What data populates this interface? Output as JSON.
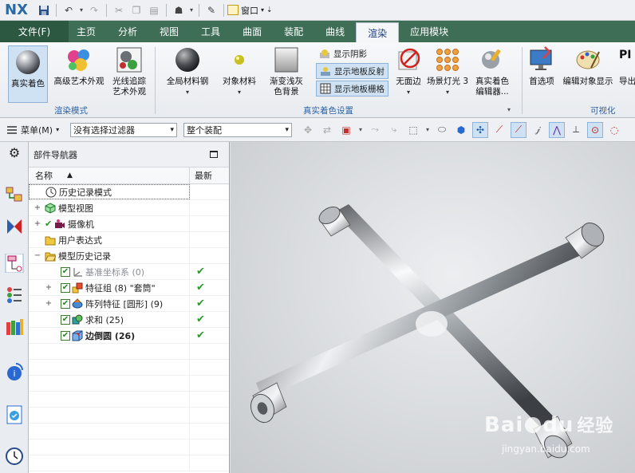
{
  "app": {
    "logo": "NX",
    "window_menu_label": "窗口"
  },
  "tabs": {
    "file": "文件(F)",
    "items": [
      "主页",
      "分析",
      "视图",
      "工具",
      "曲面",
      "装配",
      "曲线",
      "渲染",
      "应用模块"
    ],
    "active": "渲染"
  },
  "ribbon": {
    "buttons": {
      "true_shading": "真实着色",
      "advanced_studio": "高级艺术外观",
      "ray_traced": "光线追踪\n艺术外观",
      "global_materials": "全局材料钢",
      "object_materials": "对象材料",
      "gradient_bg": "渐变浅灰\n色背景",
      "show_shadows": "显示阴影",
      "show_floor_reflection": "显示地板反射",
      "show_floor_grid": "显示地板栅格",
      "no_edges": "无面边",
      "scene_light": "场景灯光 3",
      "true_shading_editor": "真实着色\n编辑器...",
      "preferences": "首选项",
      "edit_object_display": "编辑对象显示",
      "export": "导出"
    },
    "groups": {
      "render_mode": "渲染模式",
      "true_shading_settings": "真实着色设置",
      "visualization": "可视化"
    }
  },
  "selection_bar": {
    "menu_label": "菜单(M)",
    "filter_value": "没有选择过滤器",
    "scope_value": "整个装配"
  },
  "part_navigator": {
    "title": "部件导航器",
    "columns": {
      "name": "名称",
      "latest": "最新"
    },
    "rows": [
      {
        "label": "历史记录模式",
        "expand": "",
        "check": false,
        "latest": ""
      },
      {
        "label": "模型视图",
        "expand": "+",
        "check": false,
        "latest": ""
      },
      {
        "label": "摄像机",
        "expand": "+",
        "check": true,
        "latest": ""
      },
      {
        "label": "用户表达式",
        "expand": "",
        "check": false,
        "latest": ""
      },
      {
        "label": "模型历史记录",
        "expand": "−",
        "check": false,
        "latest": ""
      },
      {
        "label": "基准坐标系 (0)",
        "expand": "",
        "check": true,
        "latest": "✔"
      },
      {
        "label": "特征组 (8) \"套筒\"",
        "expand": "+",
        "check": true,
        "latest": "✔"
      },
      {
        "label": "阵列特征 [圆形] (9)",
        "expand": "+",
        "check": true,
        "latest": "✔"
      },
      {
        "label": "求和 (25)",
        "expand": "",
        "check": true,
        "latest": "✔"
      },
      {
        "label": "边倒圆 (26)",
        "expand": "",
        "check": true,
        "latest": "✔"
      }
    ]
  },
  "watermark": {
    "brand": "Bai",
    "brand_mid": "du",
    "brand_cn": "经验",
    "url": "jingyan.baidu.com"
  },
  "colors": {
    "tab_bar": "#3f6e56",
    "file_tab": "#2c5740",
    "group_label": "#2d62a5",
    "check_green": "#2a9a2a"
  }
}
